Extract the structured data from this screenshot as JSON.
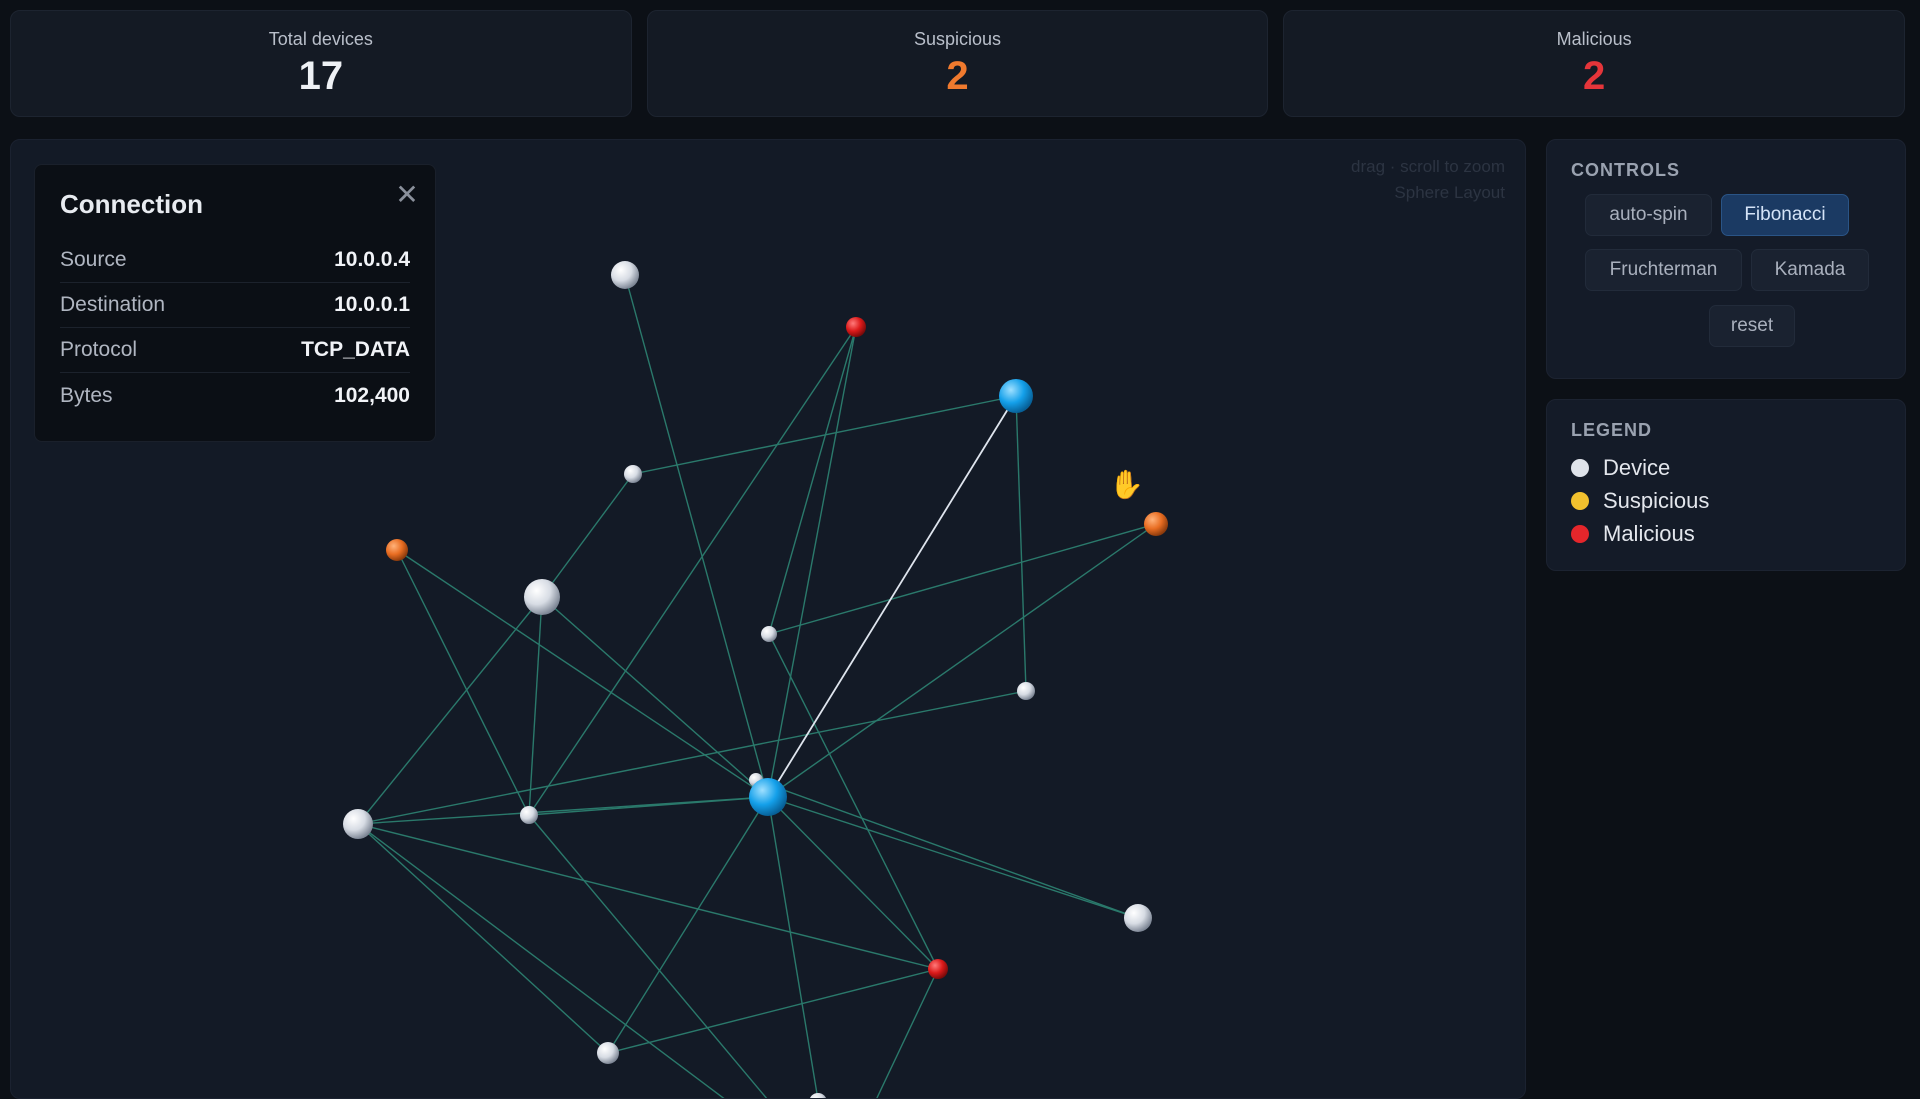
{
  "stats": {
    "total": {
      "label": "Total devices",
      "value": "17",
      "color": "#eef1f5"
    },
    "suspicious": {
      "label": "Suspicious",
      "value": "2",
      "color": "#f07a2e"
    },
    "malicious": {
      "label": "Malicious",
      "value": "2",
      "color": "#e5353a"
    }
  },
  "graph": {
    "hint_line1": "drag · scroll to zoom",
    "hint_line2": "Sphere Layout",
    "colors": {
      "edge": "#2f8a78",
      "edge_selected": "#e8edf5",
      "device": "#e3e7ee",
      "suspicious": "#f07a2e",
      "malicious": "#e31c1c",
      "selected_node": "#1aa4ee",
      "background": "#131a26"
    }
  },
  "connection": {
    "title": "Connection",
    "close_icon": "close-icon",
    "rows": [
      {
        "key": "Source",
        "value": "10.0.0.4"
      },
      {
        "key": "Destination",
        "value": "10.0.0.1"
      },
      {
        "key": "Protocol",
        "value": "TCP_DATA"
      },
      {
        "key": "Bytes",
        "value": "102,400"
      }
    ]
  },
  "controls": {
    "heading": "CONTROLS",
    "buttons": [
      {
        "label": "auto-spin",
        "active": false
      },
      {
        "label": "Fibonacci",
        "active": true
      },
      {
        "label": "Fruchterman",
        "active": false
      },
      {
        "label": "Kamada",
        "active": false
      },
      {
        "label": "reset",
        "active": false
      }
    ]
  },
  "legend": {
    "heading": "LEGEND",
    "items": [
      {
        "label": "Device",
        "color": "#dfe3ea"
      },
      {
        "label": "Suspicious",
        "color": "#f2c12e"
      },
      {
        "label": "Malicious",
        "color": "#e5262b"
      }
    ]
  },
  "cursor_icon": "hand-grab-icon"
}
